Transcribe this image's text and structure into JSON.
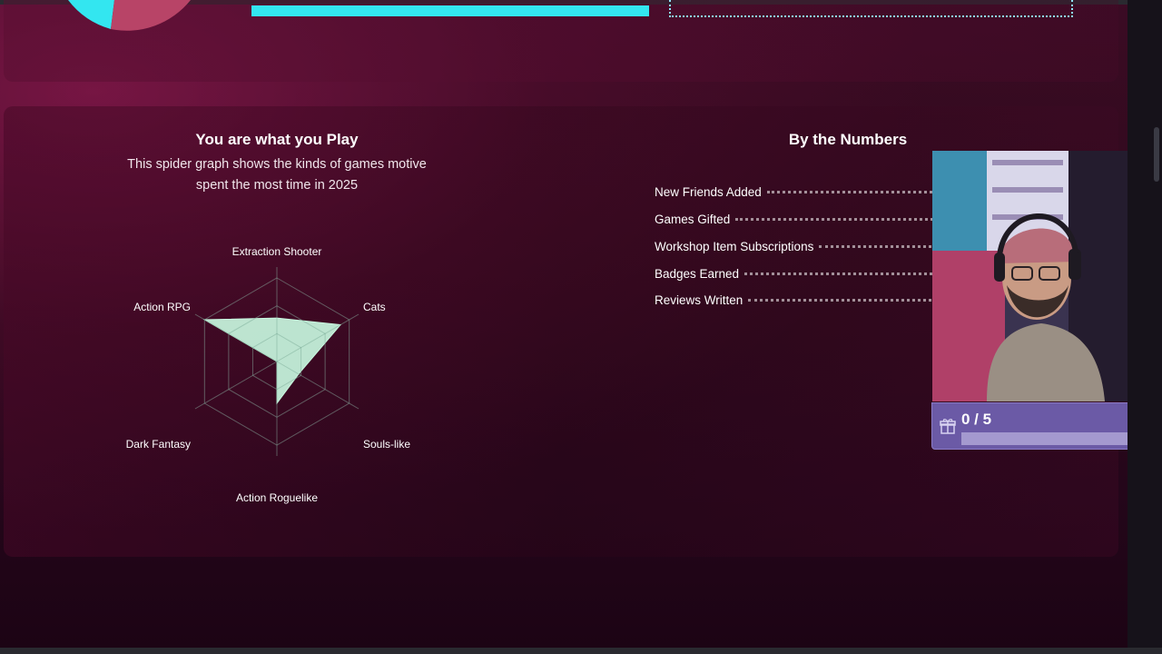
{
  "spider": {
    "title": "You are what you Play",
    "description": "This spider graph shows the kinds of games motive spent the most time in 2025",
    "axes": [
      "Extraction Shooter",
      "Cats",
      "Souls-like",
      "Action Roguelike",
      "Dark Fantasy",
      "Action RPG"
    ],
    "fill_color": "#c8f7df"
  },
  "numbers": {
    "title": "By the Numbers",
    "stats": [
      {
        "label": "New Friends Added"
      },
      {
        "label": "Games Gifted"
      },
      {
        "label": "Workshop Item Subscriptions"
      },
      {
        "label": "Badges Earned"
      },
      {
        "label": "Reviews Written"
      }
    ]
  },
  "goal": {
    "text": "0 / 5",
    "progress": 0
  },
  "colors": {
    "accent_cyan": "#33e6f0",
    "goal_purple": "#6b5aa6"
  },
  "chart_data": {
    "type": "radar",
    "axes": [
      "Extraction Shooter",
      "Cats",
      "Souls-like",
      "Action Roguelike",
      "Dark Fantasy",
      "Action RPG"
    ],
    "values": [
      0.52,
      0.88,
      0.3,
      0.5,
      0.0,
      1.0
    ],
    "scale": [
      0,
      1
    ],
    "rings": 3
  }
}
